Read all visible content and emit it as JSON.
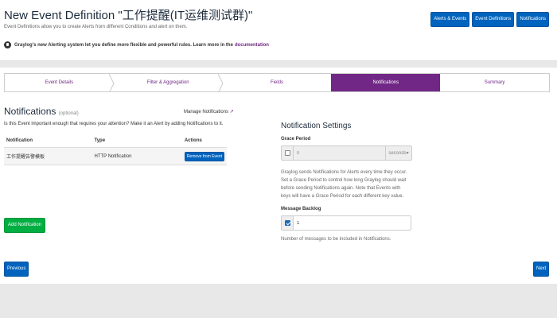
{
  "header": {
    "title": "New Event Definition \"工作提醒(IT运维测试群)\"",
    "subtitle": "Event Definitions allow you to create Alerts from different Conditions and alert on them.",
    "info_text": "Graylog's new Alerting system let you define more flexible and powerful rules. Learn more in the",
    "info_link": "documentation",
    "buttons": [
      "Alerts & Events",
      "Event Definitions",
      "Notifications"
    ]
  },
  "wizard": {
    "steps": [
      "Event Details",
      "Filter & Aggregation",
      "Fields",
      "Notifications",
      "Summary"
    ],
    "active_index": 3
  },
  "notifications": {
    "title": "Notifications",
    "optional": "(optional)",
    "manage_link": "Manage Notifications",
    "description": "Is this Event important enough that requires your attention? Make it an Alert by adding Notifications to it.",
    "columns": [
      "Notification",
      "Type",
      "Actions"
    ],
    "rows": [
      {
        "name": "工作提醒告警模板",
        "type": "HTTP Notification",
        "action": "Remove from Event"
      }
    ],
    "add_button": "Add Notification"
  },
  "settings": {
    "title": "Notification Settings",
    "grace_label": "Grace Period",
    "grace_value": "0",
    "grace_unit": "seconds",
    "grace_help": "Graylog sends Notifications for Alerts every time they occur. Set a Grace Period to control how long Graylog should wait before sending Notifications again. Note that Events with keys will have a Grace Period for each different key value.",
    "backlog_label": "Message Backlog",
    "backlog_value": "1",
    "backlog_help": "Number of messages to be included in Notifications."
  },
  "footer": {
    "previous": "Previous",
    "next": "Next"
  },
  "colors": {
    "accent": "#702785",
    "primary": "#0063be",
    "success": "#00ae42"
  }
}
